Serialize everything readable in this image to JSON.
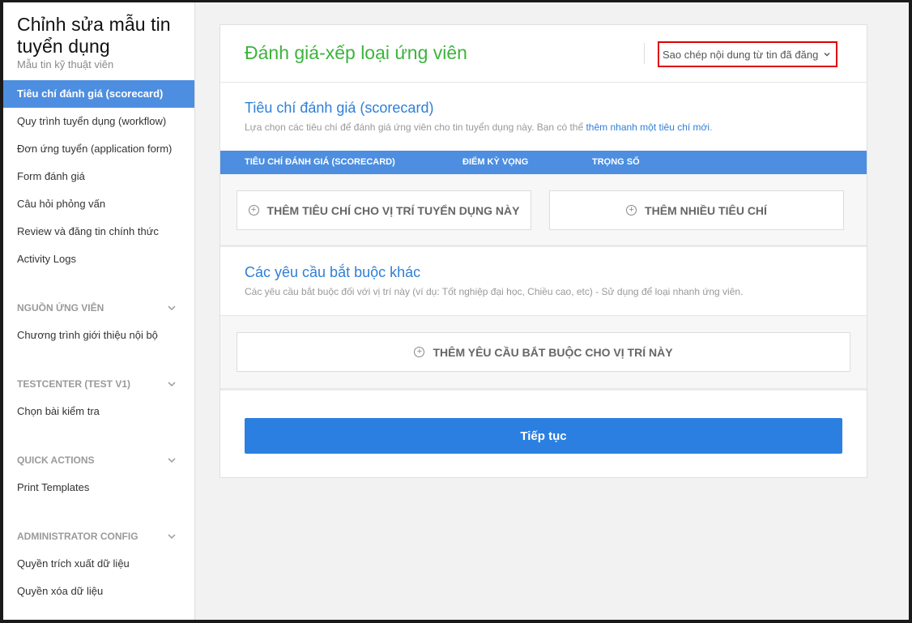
{
  "sidebar": {
    "title": "Chỉnh sửa mẫu tin tuyển dụng",
    "subtitle": "Mẫu tin kỹ thuật viên",
    "items": [
      {
        "label": "Tiêu chí đánh giá (scorecard)",
        "active": true
      },
      {
        "label": "Quy trình tuyển dụng (workflow)"
      },
      {
        "label": "Đơn ứng tuyển (application form)"
      },
      {
        "label": "Form đánh giá"
      },
      {
        "label": "Câu hỏi phỏng vấn"
      },
      {
        "label": "Review và đăng tin chính thức"
      },
      {
        "label": "Activity Logs"
      }
    ],
    "sections": [
      {
        "label": "NGUỒN ỨNG VIÊN",
        "items": [
          "Chương trình giới thiệu nội bộ"
        ]
      },
      {
        "label": "TESTCENTER (TEST V1)",
        "items": [
          "Chọn bài kiểm tra"
        ]
      },
      {
        "label": "QUICK ACTIONS",
        "items": [
          "Print Templates"
        ]
      },
      {
        "label": "ADMINISTRATOR CONFIG",
        "items": [
          "Quyền trích xuất dữ liệu",
          "Quyền xóa dữ liệu"
        ]
      }
    ]
  },
  "header": {
    "title": "Đánh giá-xếp loại ứng viên",
    "copy_select": "Sao chép nội dung từ tin đã đăng"
  },
  "scorecard": {
    "title": "Tiêu chí đánh giá (scorecard)",
    "desc": "Lựa chọn các tiêu chí để đánh giá ứng viên cho tin tuyển dụng này. Bạn có thể ",
    "desc_link": "thêm nhanh một tiêu chí mới",
    "desc_end": ".",
    "columns": [
      "TIÊU CHÍ ĐÁNH GIÁ (SCORECARD)",
      "ĐIỂM KỲ VỌNG",
      "TRỌNG SỐ"
    ],
    "add_one": "THÊM TIÊU CHÍ CHO VỊ TRÍ TUYỂN DỤNG NÀY",
    "add_many": "THÊM NHIỀU TIÊU CHÍ"
  },
  "requirements": {
    "title": "Các yêu cầu bắt buộc khác",
    "desc": "Các yêu cầu bắt buộc đối với vị trí này (ví dụ: Tốt nghiệp đại học, Chiều cao, etc) - Sử dụng để loại nhanh ứng viên.",
    "add": "THÊM YÊU CẦU BẮT BUỘC CHO VỊ TRÍ NÀY"
  },
  "continue_label": "Tiếp tục",
  "colors": {
    "accent": "#4d8ee0",
    "title_green": "#3db33d",
    "primary": "#2b7fe0",
    "highlight": "#e00000"
  }
}
